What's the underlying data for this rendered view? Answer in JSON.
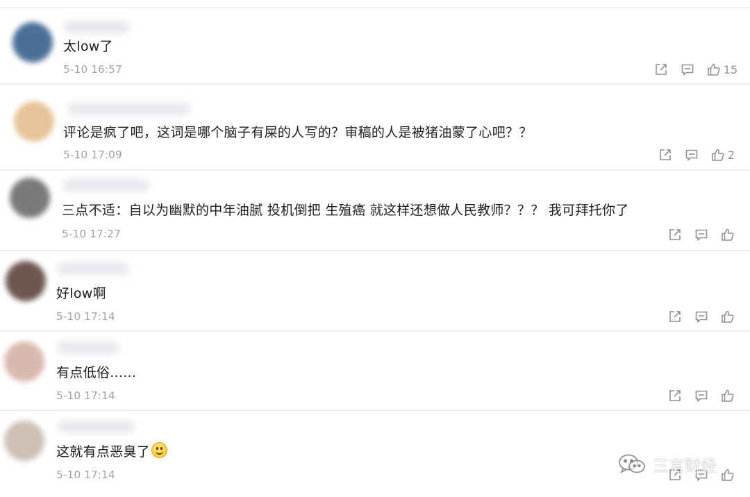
{
  "comments": [
    {
      "text": "太low了",
      "time": "5-10 16:57",
      "likes": "15",
      "avatar_color": "#4c6f98"
    },
    {
      "text": "评论是疯了吧，这词是哪个脑子有屎的人写的？审稿的人是被猪油蒙了心吧？？",
      "time": "5-10 17:09",
      "likes": "2",
      "avatar_color": "#e6c49a"
    },
    {
      "text": "三点不适：自以为幽默的中年油腻 投机倒把 生殖癌 就这样还想做人民教师？？？ 我可拜托你了",
      "time": "5-10 17:27",
      "likes": "",
      "avatar_color": "#7a7a7c"
    },
    {
      "text": "好low啊",
      "time": "5-10 17:14",
      "likes": "",
      "avatar_color": "#6e5750"
    },
    {
      "text": "有点低俗......",
      "time": "5-10 17:14",
      "likes": "",
      "avatar_color": "#d9b8ae"
    },
    {
      "text": "这就有点恶臭了",
      "time": "5-10 17:14",
      "likes": "",
      "avatar_color": "#cdbfb4"
    }
  ],
  "watermark": {
    "label": "三言财经"
  }
}
